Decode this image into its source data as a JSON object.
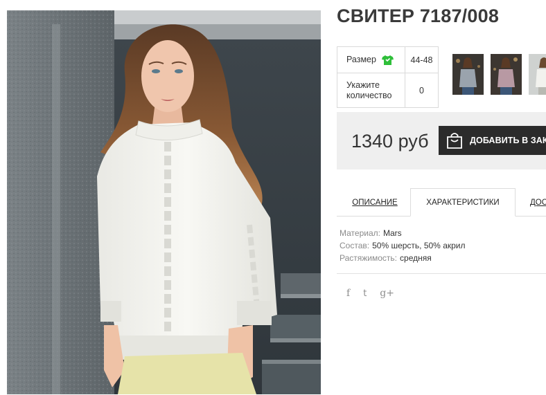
{
  "product": {
    "title": "СВИТЕР 7187/008",
    "photo_icon": "product-photo"
  },
  "options": {
    "size_label": "Размер",
    "size_icon": "tshirt-icon",
    "size_icon_color": "#2fbf3a",
    "size_value": "44-48",
    "qty_label_line1": "Укажите",
    "qty_label_line2": "количество",
    "qty_value": "0"
  },
  "thumbnails": [
    {
      "name": "thumb-grey-sweater",
      "color": "#9aa3ad"
    },
    {
      "name": "thumb-mauve-sweater",
      "color": "#b899a3"
    },
    {
      "name": "thumb-white-sweater",
      "color": "#f2f2ee"
    }
  ],
  "purchase": {
    "price": "1340 руб",
    "buy_label": "ДОБАВИТЬ В ЗАКАЗ",
    "buy_icon": "shopping-bag-icon",
    "bar_color": "#efefef",
    "button_color": "#2b2b2b"
  },
  "tabs": [
    {
      "label": "ОПИСАНИЕ",
      "active": false
    },
    {
      "label": "ХАРАКТЕРИСТИКИ",
      "active": true
    },
    {
      "label": "ДОСТАВКА",
      "active": false
    }
  ],
  "specs": [
    {
      "key": "Материал:",
      "value": "Mars"
    },
    {
      "key": "Состав:",
      "value": "50% шерсть, 50% акрил"
    },
    {
      "key": "Растяжимость:",
      "value": "средняя"
    }
  ],
  "social": [
    {
      "name": "facebook-icon",
      "glyph": "f"
    },
    {
      "name": "twitter-icon",
      "glyph": "t"
    },
    {
      "name": "google-plus-icon",
      "glyph": "g+"
    }
  ]
}
